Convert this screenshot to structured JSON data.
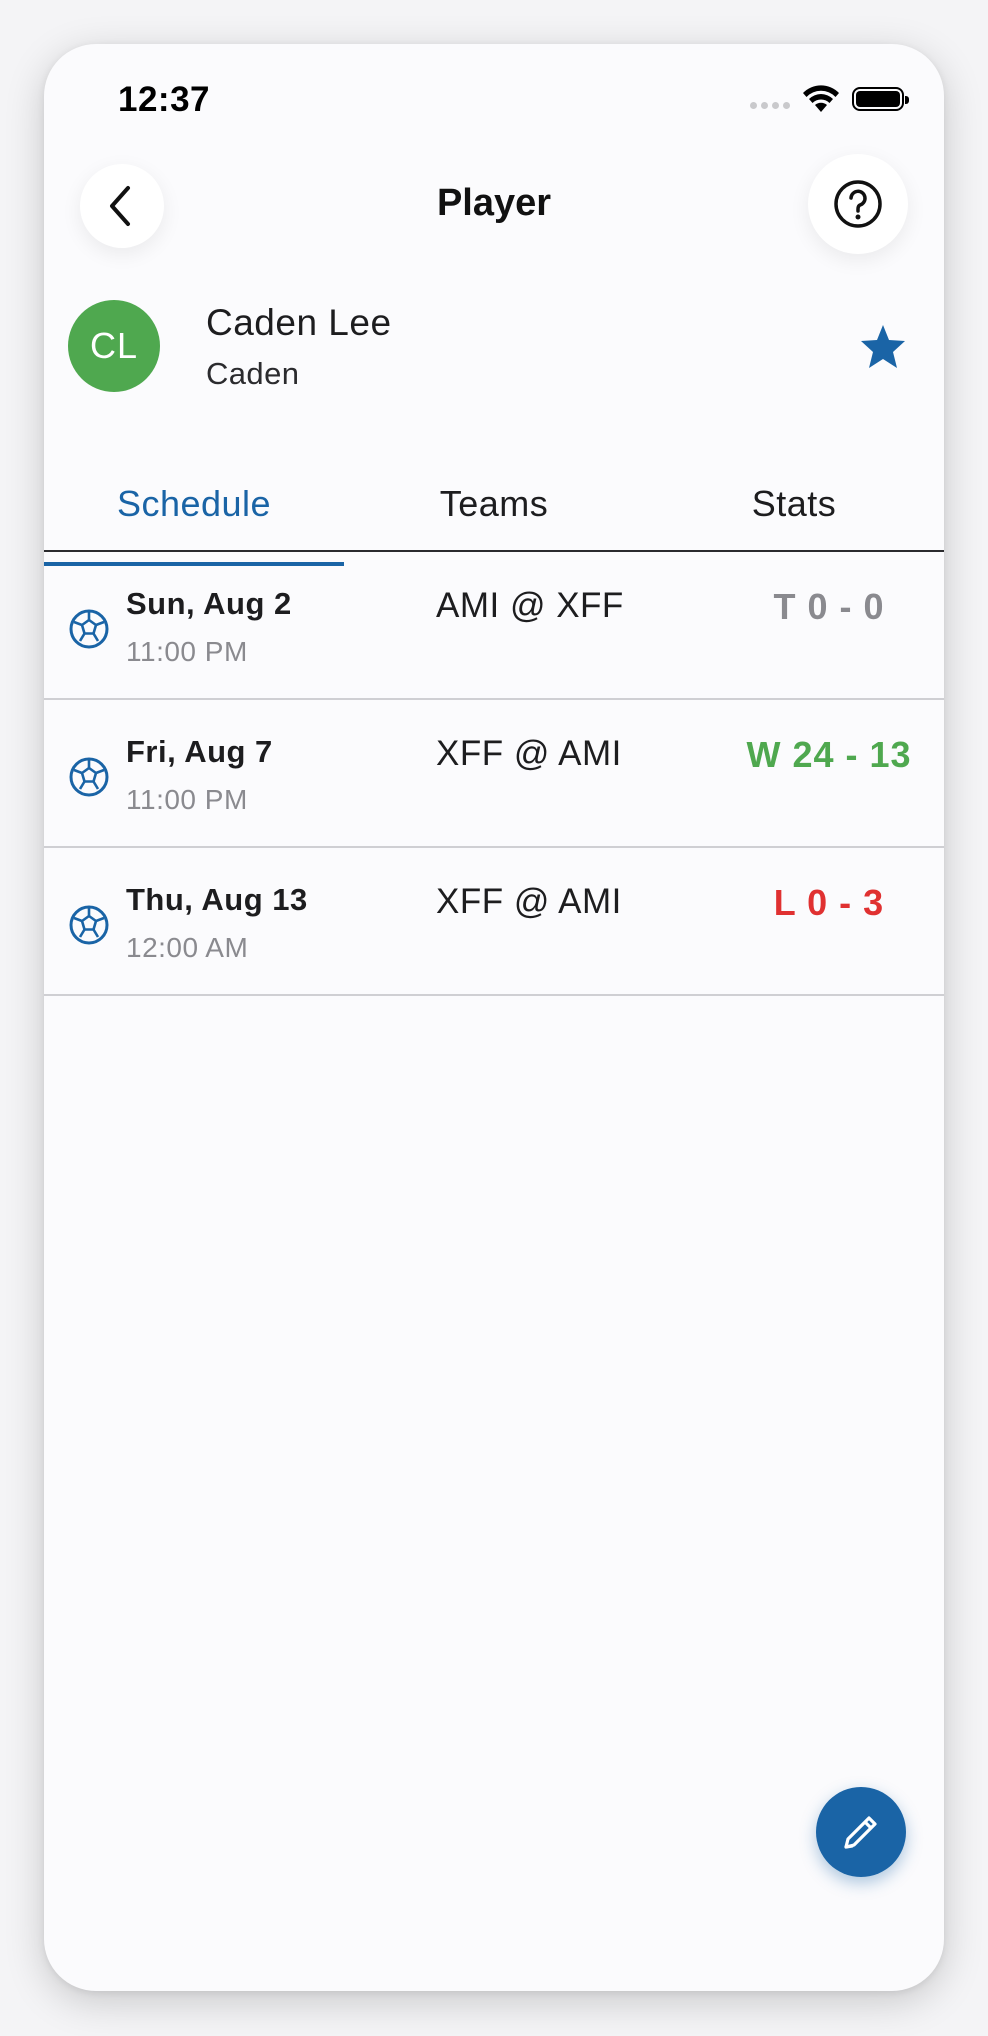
{
  "status_bar": {
    "time": "12:37"
  },
  "header": {
    "title": "Player"
  },
  "player": {
    "initials": "CL",
    "name": "Caden Lee",
    "nickname": "Caden",
    "avatar_color": "#4fa84f",
    "favorite": true
  },
  "tabs": [
    {
      "label": "Schedule",
      "active": true
    },
    {
      "label": "Teams",
      "active": false
    },
    {
      "label": "Stats",
      "active": false
    }
  ],
  "schedule": [
    {
      "date": "Sun, Aug 2",
      "time": "11:00 PM",
      "matchup": "AMI @ XFF",
      "result": "T 0 - 0",
      "result_color": "#8a8a8f"
    },
    {
      "date": "Fri, Aug 7",
      "time": "11:00 PM",
      "matchup": "XFF @ AMI",
      "result": "W 24 - 13",
      "result_color": "#4fa84f"
    },
    {
      "date": "Thu, Aug 13",
      "time": "12:00 AM",
      "matchup": "XFF @ AMI",
      "result": "L 0 - 3",
      "result_color": "#e03131"
    }
  ],
  "colors": {
    "accent": "#1a64a6",
    "win": "#4fa84f",
    "loss": "#e03131",
    "tie": "#8a8a8f"
  },
  "icons": {
    "back": "chevron-left-icon",
    "help": "question-circle-icon",
    "favorite": "star-icon",
    "sport": "soccer-ball-icon",
    "edit": "pencil-icon"
  }
}
